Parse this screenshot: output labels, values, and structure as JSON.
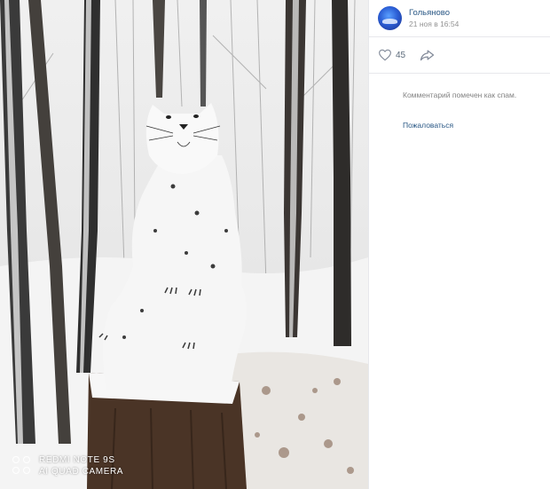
{
  "post": {
    "author": "Гольяново",
    "date": "21 ноя в 16:54",
    "likes": "45"
  },
  "comments": {
    "spam_note": "Комментарий помечен как спам.",
    "report_link": "Пожаловаться"
  },
  "photo": {
    "watermark_line1": "REDMI NOTE 9S",
    "watermark_line2": "AI QUAD CAMERA"
  },
  "icons": {
    "like": "heart-icon",
    "share": "share-arrow-icon"
  },
  "colors": {
    "link": "#2a5885",
    "muted": "#939393",
    "divider": "#e7e8ec"
  }
}
